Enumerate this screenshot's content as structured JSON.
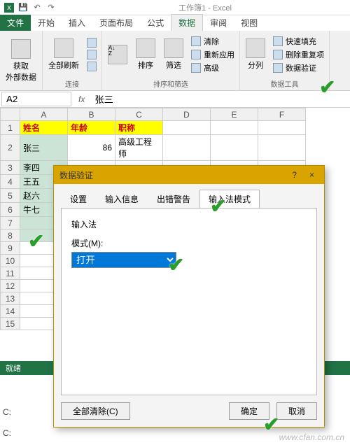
{
  "titlebar": {
    "title": "工作簿1 - Excel"
  },
  "tabs": {
    "file": "文件",
    "home": "开始",
    "insert": "插入",
    "layout": "页面布局",
    "formula": "公式",
    "data": "数据",
    "review": "审阅",
    "view": "视图"
  },
  "ribbon": {
    "g1": {
      "btn": "获取\n外部数据",
      "label": "连接"
    },
    "g2": {
      "btn": "全部刷新"
    },
    "g3": {
      "sort": "排序",
      "filter": "筛选",
      "clear": "清除",
      "reapply": "重新应用",
      "adv": "高级",
      "label": "排序和筛选"
    },
    "g4": {
      "split": "分列",
      "flash": "快速填充",
      "dup": "删除重复项",
      "val": "数据验证",
      "label": "数据工具"
    }
  },
  "namebox": {
    "ref": "A2",
    "fx": "fx",
    "value": "张三"
  },
  "gridcols": [
    "A",
    "B",
    "C",
    "D",
    "E",
    "F"
  ],
  "gridrows": [
    "1",
    "2",
    "3",
    "4",
    "5",
    "6",
    "7",
    "8",
    "9",
    "10",
    "11",
    "12",
    "13",
    "14",
    "15"
  ],
  "headers": {
    "name": "姓名",
    "age": "年龄",
    "title": "职称"
  },
  "data": {
    "r2": {
      "a": "张三",
      "b": "86",
      "c": "高级工程师"
    },
    "r3": {
      "a": "李四"
    },
    "r4": {
      "a": "王五"
    },
    "r5": {
      "a": "赵六"
    },
    "r6": {
      "a": "牛七"
    }
  },
  "status": "就绪",
  "dialog": {
    "title": "数据验证",
    "help": "?",
    "close": "×",
    "tabs": {
      "settings": "设置",
      "input": "输入信息",
      "error": "出错警告",
      "ime": "输入法模式"
    },
    "section": "输入法",
    "modeLabel": "模式(M):",
    "modeValue": "打开",
    "clearAll": "全部清除(C)",
    "ok": "确定",
    "cancel": "取消"
  },
  "footer": {
    "c1": "C:",
    "c2": "C:"
  },
  "watermark": "www.cfan.com.cn"
}
